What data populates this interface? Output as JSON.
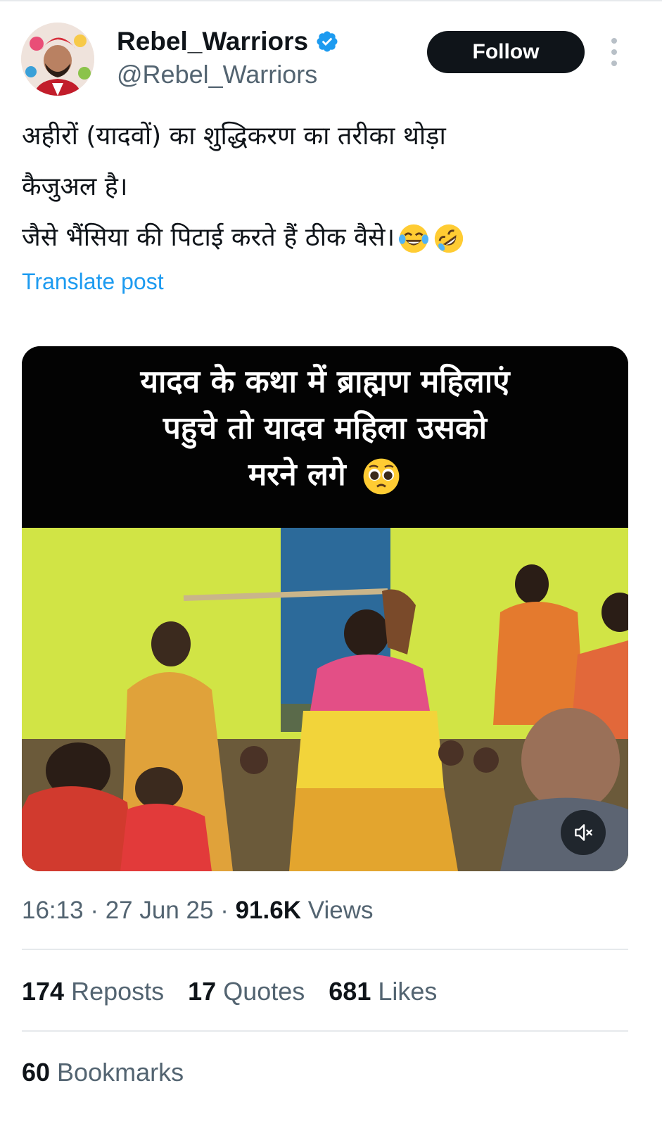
{
  "author": {
    "name": "Rebel_Warriors",
    "handle": "@Rebel_Warriors",
    "verified": true,
    "follow_label": "Follow"
  },
  "post": {
    "lines": [
      "अहीरों (यादवों) का शुद्धिकरण का तरीका थोड़ा",
      "कैजुअल है।",
      "जैसे भैंसिया की पिटाई करते हैं ठीक वैसे।"
    ],
    "emojis": [
      "face-with-tears-of-joy",
      "rolling-on-the-floor-laughing"
    ],
    "translate_label": "Translate post"
  },
  "media": {
    "caption_lines": [
      "यादव के कथा में ब्राह्मण महिलाएं",
      "पहुचे तो यादव महिला उसको",
      "मरने लगे"
    ],
    "caption_emoji": "pleading-face",
    "muted": true
  },
  "meta": {
    "time": "16:13",
    "date": "27 Jun 25",
    "views_count": "91.6K",
    "views_label": "Views"
  },
  "stats": {
    "reposts_count": "174",
    "reposts_label": "Reposts",
    "quotes_count": "17",
    "quotes_label": "Quotes",
    "likes_count": "681",
    "likes_label": "Likes"
  },
  "bookmarks": {
    "count": "60",
    "label": "Bookmarks"
  },
  "colors": {
    "accent": "#1d9bf0",
    "text_primary": "#0f1419",
    "text_secondary": "#536471",
    "follow_bg": "#0f1419"
  }
}
